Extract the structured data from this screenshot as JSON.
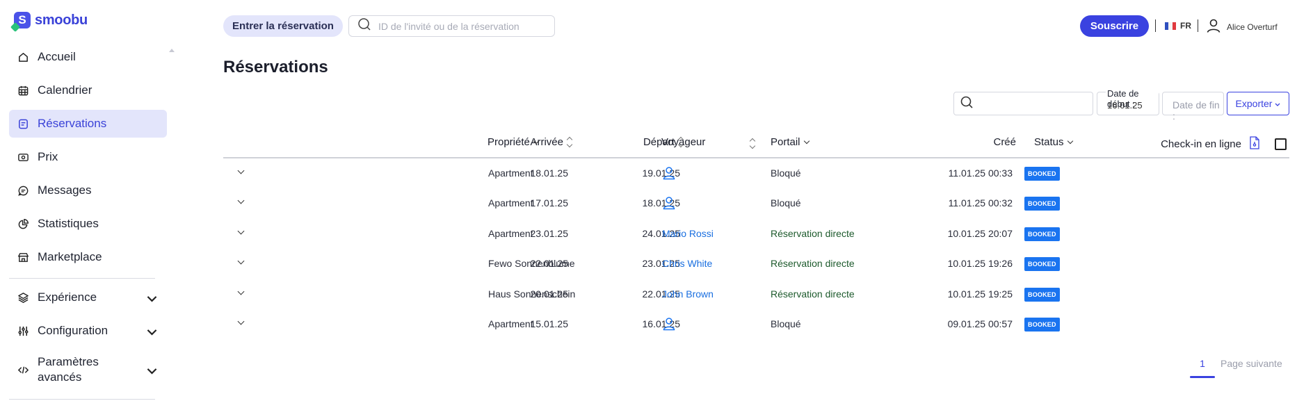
{
  "app": {
    "brand": "smoobu",
    "accent": "#3a42e0"
  },
  "sidebar": {
    "items": [
      {
        "label": "Accueil",
        "icon": "home-icon"
      },
      {
        "label": "Calendrier",
        "icon": "calendar-icon"
      },
      {
        "label": "Réservations",
        "icon": "reservations-icon",
        "active": true
      },
      {
        "label": "Prix",
        "icon": "price-icon"
      },
      {
        "label": "Messages",
        "icon": "messages-icon"
      },
      {
        "label": "Statistiques",
        "icon": "statistics-icon"
      },
      {
        "label": "Marketplace",
        "icon": "store-icon"
      }
    ],
    "groups": [
      {
        "label": "Expérience",
        "icon": "layers-icon"
      },
      {
        "label": "Configuration",
        "icon": "sliders-icon"
      },
      {
        "label_line1": "Paramètres",
        "label_line2": "avancés",
        "icon": "code-icon"
      }
    ]
  },
  "header": {
    "enter_reservation": "Entrer la réservation",
    "search_placeholder": "ID de l'invité ou de la réservation",
    "subscribe": "Souscrire",
    "language": "FR",
    "user_name": "Alice Overturf"
  },
  "page": {
    "title": "Réservations"
  },
  "filters": {
    "start_label": "Date de début :",
    "start_value": "16.01.25",
    "end_placeholder": "Date de fin :",
    "export": "Exporter"
  },
  "table": {
    "headers": {
      "arrival": "Arrivée",
      "departure": "Départ",
      "property": "Propriété",
      "guest": "Voyageur",
      "portal": "Portail",
      "created": "Créé",
      "status": "Status",
      "checkin": "Check-in en ligne"
    },
    "rows": [
      {
        "arrival": "18.01.25",
        "departure": "19.01.25",
        "property": "Apartment",
        "guest": "",
        "portal": "Bloqué",
        "portal_type": "blocked",
        "created": "11.01.25 00:33",
        "status": "BOOKED"
      },
      {
        "arrival": "17.01.25",
        "departure": "18.01.25",
        "property": "Apartment",
        "guest": "",
        "portal": "Bloqué",
        "portal_type": "blocked",
        "created": "11.01.25 00:32",
        "status": "BOOKED"
      },
      {
        "arrival": "23.01.25",
        "departure": "24.01.25",
        "property": "Apartment",
        "guest": "Mario Rossi",
        "portal": "Réservation directe",
        "portal_type": "direct",
        "created": "10.01.25 20:07",
        "status": "BOOKED"
      },
      {
        "arrival": "22.01.25",
        "departure": "23.01.25",
        "property": "Fewo Sonnenblume",
        "guest": "Chris White",
        "portal": "Réservation directe",
        "portal_type": "direct",
        "created": "10.01.25 19:26",
        "status": "BOOKED"
      },
      {
        "arrival": "20.01.25",
        "departure": "22.01.25",
        "property": "Haus Sonnenschein",
        "guest": "John Brown",
        "portal": "Réservation directe",
        "portal_type": "direct",
        "created": "10.01.25 19:25",
        "status": "BOOKED"
      },
      {
        "arrival": "15.01.25",
        "departure": "16.01.25",
        "property": "Apartment",
        "guest": "",
        "portal": "Bloqué",
        "portal_type": "blocked",
        "created": "09.01.25 00:57",
        "status": "BOOKED"
      }
    ]
  },
  "pagination": {
    "current": "1",
    "next": "Page suivante"
  }
}
